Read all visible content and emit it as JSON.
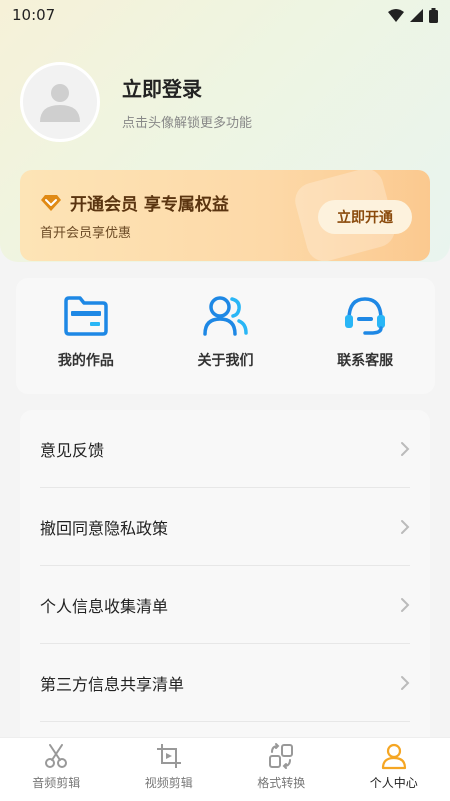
{
  "status_bar": {
    "time": "10:07"
  },
  "profile": {
    "title": "立即登录",
    "subtitle": "点击头像解锁更多功能"
  },
  "vip": {
    "title": "开通会员 享专属权益",
    "subtitle": "首开会员享优惠",
    "button": "立即开通"
  },
  "shortcuts": [
    {
      "label": "我的作品",
      "icon": "folder-icon"
    },
    {
      "label": "关于我们",
      "icon": "users-icon"
    },
    {
      "label": "联系客服",
      "icon": "headset-icon"
    }
  ],
  "menu": [
    {
      "label": "意见反馈"
    },
    {
      "label": "撤回同意隐私政策"
    },
    {
      "label": "个人信息收集清单"
    },
    {
      "label": "第三方信息共享清单"
    }
  ],
  "tabs": [
    {
      "label": "音频剪辑",
      "icon": "scissors-icon",
      "active": false
    },
    {
      "label": "视频剪辑",
      "icon": "video-edit-icon",
      "active": false
    },
    {
      "label": "格式转换",
      "icon": "convert-icon",
      "active": false
    },
    {
      "label": "个人中心",
      "icon": "person-icon",
      "active": true
    }
  ],
  "colors": {
    "accent": "#2196f3",
    "vip_text": "#5a3410",
    "active_tab_icon": "#f5a623"
  }
}
